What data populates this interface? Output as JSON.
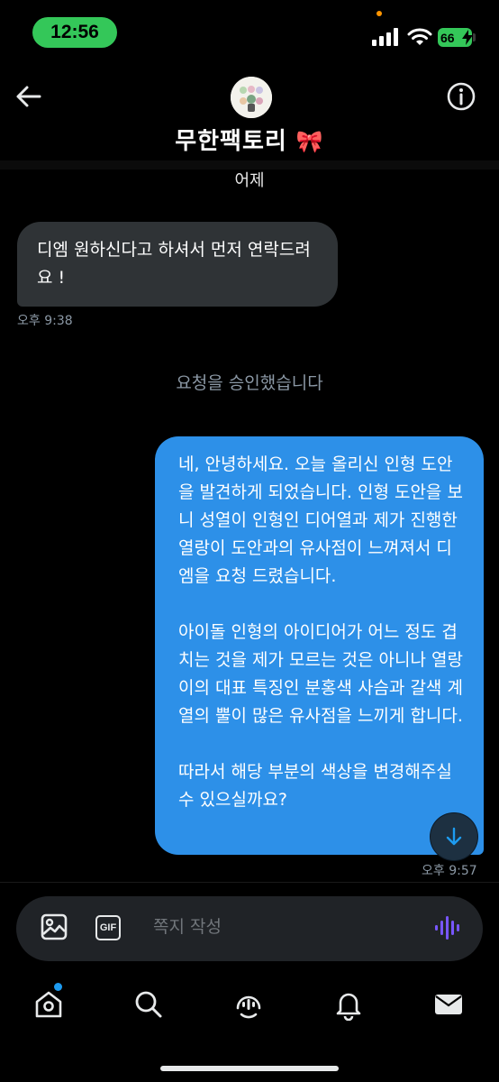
{
  "status_bar": {
    "time": "12:56",
    "battery": "66"
  },
  "header": {
    "contact_name": "무한팩토리",
    "name_emoji": "🎀"
  },
  "conversation": {
    "date_label": "어제",
    "received": {
      "text": "디엠 원하신다고 하셔서 먼저 연락드려요 !",
      "timestamp": "오후 9:38"
    },
    "system_message": "요청을 승인했습니다",
    "sent": {
      "paragraphs": [
        "네, 안녕하세요. 오늘 올리신 인형 도안을 발견하게 되었습니다. 인형 도안을 보니 성열이 인형인 디어열과 제가 진행한 열랑이 도안과의 유사점이 느껴져서 디엠을 요청 드렸습니다.",
        "아이돌 인형의 아이디어가 어느 정도 겹치는 것을 제가 모르는 것은 아니나 열랑이의 대표 특징인 분홍색 사슴과 갈색 계열의 뿔이 많은 유사점을 느끼게 합니다.",
        "따라서 해당 부분의 색상을 변경해주실 수 있으실까요?"
      ],
      "timestamp": "오후 9:57"
    }
  },
  "composer": {
    "placeholder": "쪽지 작성",
    "gif_label": "GIF"
  },
  "tabs": [
    {
      "icon": "home-icon"
    },
    {
      "icon": "search-icon"
    },
    {
      "icon": "spaces-icon"
    },
    {
      "icon": "notifications-icon"
    },
    {
      "icon": "messages-icon"
    }
  ],
  "colors": {
    "sent_bubble": "#2d90e8",
    "received_bubble": "#2f3336",
    "status_green": "#34c759",
    "voice_accent": "#7856ff"
  }
}
